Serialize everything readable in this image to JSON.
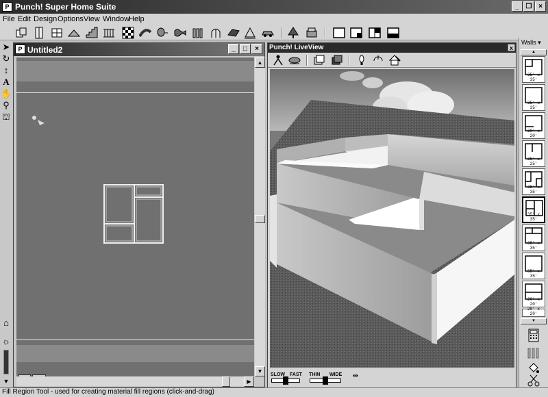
{
  "app": {
    "title": "Punch! Super Home Suite",
    "icon_label": "P",
    "caption_buttons": [
      "minimize",
      "restore",
      "close"
    ]
  },
  "menu": [
    "File",
    "Edit",
    "Design",
    "Options",
    "View",
    "Window",
    "Help"
  ],
  "toolbar_icons": [
    "room-icon",
    "door-icon",
    "window-icon",
    "roof-icon",
    "stair-icon",
    "railing-icon",
    "fence-icon",
    "pattern-icon",
    "path-icon",
    "plant-icon",
    "deck-icon",
    "arch-icon",
    "slab-icon",
    "dimension-icon",
    "car-icon",
    "tree-icon",
    "furniture-icon",
    "view-single-icon",
    "view-split-left-icon",
    "view-split-right-icon",
    "view-split-bottom-icon"
  ],
  "doc_window": {
    "title": "Untitled2",
    "icon_label": "P"
  },
  "liveview": {
    "title": "Punch! LiveView",
    "close_label": "x",
    "slow_label": "SLOW",
    "fast_label": "FAST",
    "thin_label": "THIN",
    "wide_label": "WIDE"
  },
  "right_panel": {
    "category": "Walls",
    "thumbnails": [
      "35' x 35'",
      "35' x 35'",
      "20' x 20'",
      "25' x 25'",
      "35' x 35'",
      "35' x 35'",
      "35' x 35'",
      "35' x 35'",
      "20' x 20'",
      "20' x 20'"
    ]
  },
  "status": {
    "text": "Fill Region Tool - used for creating material fill regions (click-and-drag)"
  },
  "colors": {
    "canvas": "#707070",
    "titlebar": "#2a2a2a",
    "chrome": "#d4d4d4"
  }
}
